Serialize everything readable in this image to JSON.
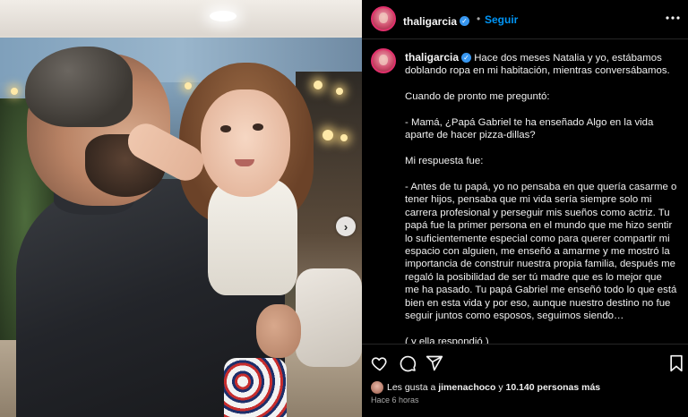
{
  "post": {
    "username": "thaligarcia",
    "separator": "•",
    "follow_label": "Seguir",
    "more_icon": "more-horizontal-icon",
    "verified_icon": "verified-badge-icon"
  },
  "caption": {
    "username": "thaligarcia",
    "first_line": "Hace dos meses Natalia y yo, estábamos doblando ropa en mi habitación, mientras conversábamos.",
    "paragraphs": [
      "Cuando de pronto me preguntó:",
      "- Mamá, ¿Papá Gabriel te ha enseñado Algo en la vida aparte de hacer pizza-dillas?",
      "Mi respuesta fue:",
      "- Antes de tu papá, yo no pensaba en que quería casarme o tener hijos, pensaba que mi vida sería siempre solo mi carrera profesional y perseguir mis sueños como actriz. Tu papá fue la primer persona en el mundo que me hizo sentir lo suficientemente especial como para querer compartir mi espacio con alguien, me enseñó a amarme y me mostró la importancia de construir nuestra propia familia, después me regaló la posibilidad de ser tú madre que es lo mejor que me ha pasado. Tu papá Gabriel me enseñó todo lo que está bien en esta vida y por eso, aunque nuestro destino no fue seguir juntos como esposos, seguimos siendo…",
      "( y ella respondió )"
    ]
  },
  "actions": {
    "like_icon": "heart-icon",
    "comment_icon": "comment-icon",
    "share_icon": "share-icon",
    "save_icon": "bookmark-icon"
  },
  "likes": {
    "prefix": "Les gusta a",
    "user": "jimenachoco",
    "connector": "y",
    "others": "10.140 personas más"
  },
  "timestamp": "Hace 6 horas",
  "carousel": {
    "next_glyph": "›"
  }
}
